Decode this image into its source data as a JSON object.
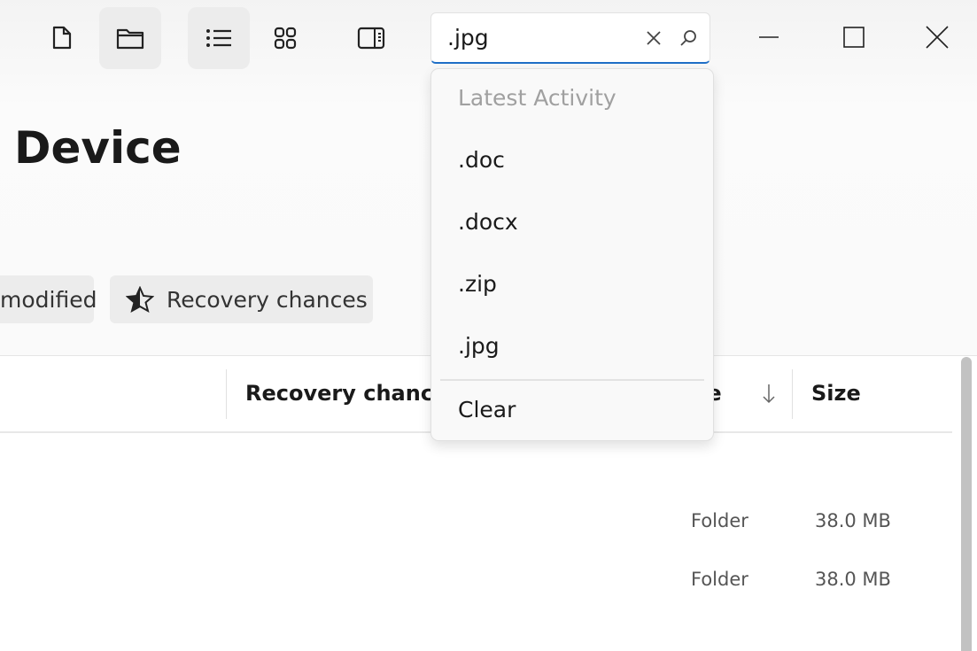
{
  "toolbar": {
    "icons": [
      "file-icon",
      "folder-icon",
      "list-view-icon",
      "grid-view-icon",
      "details-pane-icon"
    ],
    "selected": [
      "folder-icon",
      "list-view-icon"
    ]
  },
  "search": {
    "value": ".jpg",
    "accent": "#1f6fc7"
  },
  "dropdown": {
    "header": "Latest Activity",
    "items": [
      ".doc",
      ".docx",
      ".zip",
      ".jpg"
    ],
    "clear": "Clear"
  },
  "page": {
    "title": "Device"
  },
  "filters": [
    {
      "label": "modified"
    },
    {
      "label": "Recovery chances",
      "icon": "star-icon"
    }
  ],
  "table": {
    "headers": {
      "recovery": "Recovery chance",
      "type": "Type",
      "size": "Size"
    },
    "sort": "descending",
    "rows": [
      {
        "type": "Folder",
        "size": "38.0 MB"
      },
      {
        "type": "Folder",
        "size": "38.0 MB"
      }
    ]
  }
}
